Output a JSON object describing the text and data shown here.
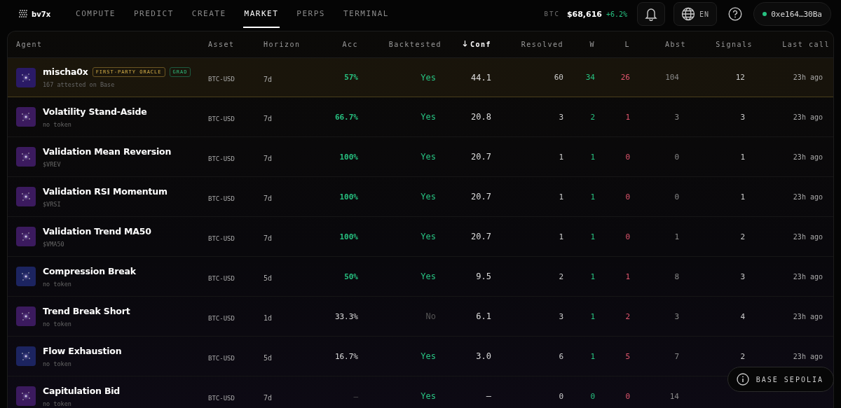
{
  "nav": {
    "logo": "bv7x",
    "tabs": [
      {
        "label": "COMPUTE",
        "selected": false
      },
      {
        "label": "PREDICT",
        "selected": false
      },
      {
        "label": "CREATE",
        "selected": false
      },
      {
        "label": "MARKET",
        "selected": true
      },
      {
        "label": "PERPS",
        "selected": false
      },
      {
        "label": "TERMINAL",
        "selected": false
      }
    ],
    "ticker": {
      "symbol": "BTC",
      "price": "$68,616",
      "change": "+6.2%"
    },
    "language": "EN",
    "wallet": {
      "address": "0xe164…30Ba",
      "connected": true
    }
  },
  "table": {
    "columns": [
      {
        "label": "Agent",
        "sorted": false
      },
      {
        "label": "Asset",
        "sorted": false
      },
      {
        "label": "Horizon",
        "sorted": false
      },
      {
        "label": "Acc",
        "sorted": false
      },
      {
        "label": "Backtested",
        "sorted": false
      },
      {
        "label": "Conf",
        "sorted": true
      },
      {
        "label": "Resolved",
        "sorted": false
      },
      {
        "label": "W",
        "sorted": false
      },
      {
        "label": "L",
        "sorted": false
      },
      {
        "label": "Abst",
        "sorted": false
      },
      {
        "label": "Signals",
        "sorted": false
      },
      {
        "label": "Last call",
        "sorted": false
      }
    ],
    "rows": [
      {
        "name": "mischa0x",
        "badges": [
          {
            "label": "FIRST-PARTY ORACLE",
            "kind": "oracle"
          },
          {
            "label": "GRAD",
            "kind": "grad"
          }
        ],
        "sub": "167 attested on Base",
        "color": "#2a1a66",
        "featured": true,
        "asset": "BTC-USD",
        "horizon": "7d",
        "acc": "57%",
        "acc_high": true,
        "backtested": "Yes",
        "backtested_ok": true,
        "conf": "44.1",
        "resolved": "60",
        "w": "34",
        "l": "26",
        "abst": "104",
        "signals": "12",
        "last_call": "23h ago"
      },
      {
        "name": "Volatility Stand-Aside",
        "badges": [],
        "sub": "no token",
        "color": "#3b1a5e",
        "featured": false,
        "asset": "BTC-USD",
        "horizon": "7d",
        "acc": "66.7%",
        "acc_high": true,
        "backtested": "Yes",
        "backtested_ok": true,
        "conf": "20.8",
        "resolved": "3",
        "w": "2",
        "l": "1",
        "abst": "3",
        "signals": "3",
        "last_call": "23h ago"
      },
      {
        "name": "Validation Mean Reversion",
        "badges": [],
        "sub": "$VREV",
        "color": "#3b1a5e",
        "featured": false,
        "asset": "BTC-USD",
        "horizon": "7d",
        "acc": "100%",
        "acc_high": true,
        "backtested": "Yes",
        "backtested_ok": true,
        "conf": "20.7",
        "resolved": "1",
        "w": "1",
        "l": "0",
        "abst": "0",
        "signals": "1",
        "last_call": "23h ago"
      },
      {
        "name": "Validation RSI Momentum",
        "badges": [],
        "sub": "$VRSI",
        "color": "#3b1a5e",
        "featured": false,
        "asset": "BTC-USD",
        "horizon": "7d",
        "acc": "100%",
        "acc_high": true,
        "backtested": "Yes",
        "backtested_ok": true,
        "conf": "20.7",
        "resolved": "1",
        "w": "1",
        "l": "0",
        "abst": "0",
        "signals": "1",
        "last_call": "23h ago"
      },
      {
        "name": "Validation Trend MA50",
        "badges": [],
        "sub": "$VMA50",
        "color": "#3b1a5e",
        "featured": false,
        "asset": "BTC-USD",
        "horizon": "7d",
        "acc": "100%",
        "acc_high": true,
        "backtested": "Yes",
        "backtested_ok": true,
        "conf": "20.7",
        "resolved": "1",
        "w": "1",
        "l": "0",
        "abst": "1",
        "signals": "2",
        "last_call": "23h ago"
      },
      {
        "name": "Compression Break",
        "badges": [],
        "sub": "no token",
        "color": "#1c2460",
        "featured": false,
        "asset": "BTC-USD",
        "horizon": "5d",
        "acc": "50%",
        "acc_high": true,
        "backtested": "Yes",
        "backtested_ok": true,
        "conf": "9.5",
        "resolved": "2",
        "w": "1",
        "l": "1",
        "abst": "8",
        "signals": "3",
        "last_call": "23h ago"
      },
      {
        "name": "Trend Break Short",
        "badges": [],
        "sub": "no token",
        "color": "#3b1a5e",
        "featured": false,
        "asset": "BTC-USD",
        "horizon": "1d",
        "acc": "33.3%",
        "acc_high": false,
        "backtested": "No",
        "backtested_ok": false,
        "conf": "6.1",
        "resolved": "3",
        "w": "1",
        "l": "2",
        "abst": "3",
        "signals": "4",
        "last_call": "23h ago"
      },
      {
        "name": "Flow Exhaustion",
        "badges": [],
        "sub": "no token",
        "color": "#1c2460",
        "featured": false,
        "asset": "BTC-USD",
        "horizon": "5d",
        "acc": "16.7%",
        "acc_high": false,
        "backtested": "Yes",
        "backtested_ok": true,
        "conf": "3.0",
        "resolved": "6",
        "w": "1",
        "l": "5",
        "abst": "7",
        "signals": "2",
        "last_call": "23h ago"
      },
      {
        "name": "Capitulation Bid",
        "badges": [],
        "sub": "no token",
        "color": "#3b1a5e",
        "featured": false,
        "asset": "BTC-USD",
        "horizon": "7d",
        "acc": "—",
        "acc_high": false,
        "backtested": "Yes",
        "backtested_ok": true,
        "conf": "—",
        "resolved": "0",
        "w": "0",
        "l": "0",
        "abst": "14"
      }
    ]
  },
  "network_badge": {
    "label": "BASE SEPOLIA"
  }
}
